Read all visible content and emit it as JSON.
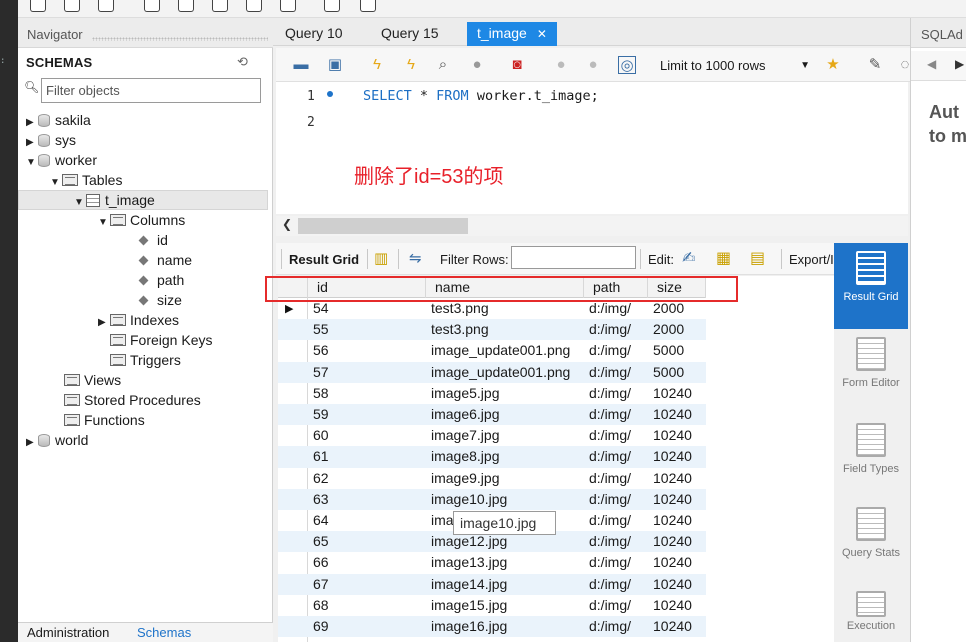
{
  "navigator": {
    "title": "Navigator",
    "schemas_label": "SCHEMAS",
    "filter_placeholder": "Filter objects",
    "tree": {
      "sakila": "sakila",
      "sys": "sys",
      "worker": "worker",
      "tables": "Tables",
      "t_image": "t_image",
      "columns": "Columns",
      "col_id": "id",
      "col_name": "name",
      "col_path": "path",
      "col_size": "size",
      "indexes": "Indexes",
      "foreign_keys": "Foreign Keys",
      "triggers": "Triggers",
      "views": "Views",
      "stored_procedures": "Stored Procedures",
      "functions": "Functions",
      "world": "world"
    },
    "bottom_tabs": {
      "administration": "Administration",
      "schemas": "Schemas"
    }
  },
  "tabs": [
    {
      "label": "Query 10"
    },
    {
      "label": "Query 15"
    },
    {
      "label": "t_image",
      "close": "✕"
    }
  ],
  "toolbar": {
    "limit": "Limit to 1000 rows"
  },
  "editor": {
    "line1": "1",
    "line2": "2",
    "sql": {
      "kw1": "SELECT",
      "star": " * ",
      "kw2": "FROM",
      "rest": " worker.t_image;"
    },
    "annotation": "删除了id=53的项"
  },
  "result_toolbar": {
    "result_grid": "Result Grid",
    "filter_rows": "Filter Rows:",
    "edit": "Edit:",
    "export": "Export/I"
  },
  "grid": {
    "columns": [
      "id",
      "name",
      "path",
      "size"
    ],
    "rows": [
      {
        "id": "54",
        "name": "test3.png",
        "path": "d:/img/",
        "size": "2000"
      },
      {
        "id": "55",
        "name": "test3.png",
        "path": "d:/img/",
        "size": "2000"
      },
      {
        "id": "56",
        "name": "image_update001.png",
        "path": "d:/img/",
        "size": "5000"
      },
      {
        "id": "57",
        "name": "image_update001.png",
        "path": "d:/img/",
        "size": "5000"
      },
      {
        "id": "58",
        "name": "image5.jpg",
        "path": "d:/img/",
        "size": "10240"
      },
      {
        "id": "59",
        "name": "image6.jpg",
        "path": "d:/img/",
        "size": "10240"
      },
      {
        "id": "60",
        "name": "image7.jpg",
        "path": "d:/img/",
        "size": "10240"
      },
      {
        "id": "61",
        "name": "image8.jpg",
        "path": "d:/img/",
        "size": "10240"
      },
      {
        "id": "62",
        "name": "image9.jpg",
        "path": "d:/img/",
        "size": "10240"
      },
      {
        "id": "63",
        "name": "image10.jpg",
        "path": "d:/img/",
        "size": "10240"
      },
      {
        "id": "64",
        "name": "ima",
        "path": "d:/img/",
        "size": "10240"
      },
      {
        "id": "65",
        "name": "image12.jpg",
        "path": "d:/img/",
        "size": "10240"
      },
      {
        "id": "66",
        "name": "image13.jpg",
        "path": "d:/img/",
        "size": "10240"
      },
      {
        "id": "67",
        "name": "image14.jpg",
        "path": "d:/img/",
        "size": "10240"
      },
      {
        "id": "68",
        "name": "image15.jpg",
        "path": "d:/img/",
        "size": "10240"
      },
      {
        "id": "69",
        "name": "image16.jpg",
        "path": "d:/img/",
        "size": "10240"
      }
    ],
    "tooltip": "image10.jpg"
  },
  "side_panel": {
    "result_grid": "Result Grid",
    "form_editor": "Form Editor",
    "field_types": "Field Types",
    "query_stats": "Query Stats",
    "execution": "Execution"
  },
  "sql_additions": {
    "title": "SQLAd",
    "text": "Aut\nto m"
  }
}
